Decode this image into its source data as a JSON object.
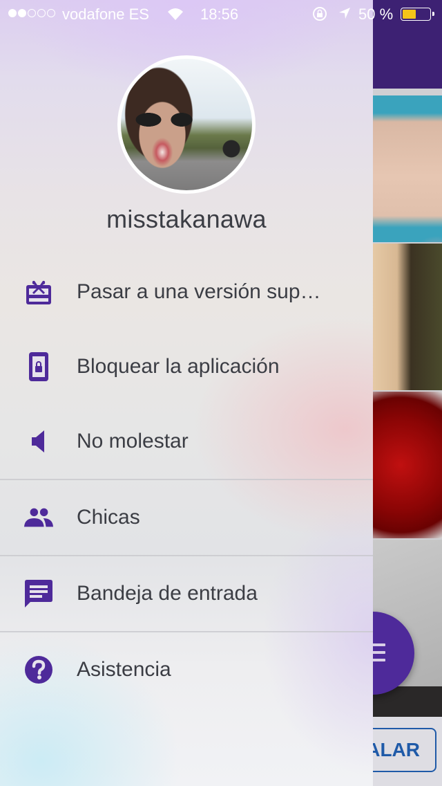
{
  "status_bar": {
    "signal_bars_filled": 2,
    "signal_bars_total": 5,
    "carrier": "vodafone ES",
    "time": "18:56",
    "battery_percent_label": "50 %",
    "battery_level": 0.5
  },
  "profile": {
    "username": "misstakanawa",
    "avatar_alt": "profile photo"
  },
  "menu": {
    "items": [
      {
        "label": "Pasar a una versión sup…",
        "icon": "gift-card-icon"
      },
      {
        "label": "Bloquear la aplicación",
        "icon": "phone-lock-icon"
      },
      {
        "label": "No molestar",
        "icon": "speaker-mute-icon"
      },
      {
        "label": "Chicas",
        "icon": "people-icon"
      },
      {
        "label": "Bandeja de entrada",
        "icon": "chat-message-icon"
      },
      {
        "label": "Asistencia",
        "icon": "help-circle-icon"
      }
    ]
  },
  "background_app": {
    "cta_label": "ALAR",
    "fab_icon": "menu-icon"
  },
  "colors": {
    "accent": "#4e2a9a",
    "header": "#3d2173",
    "text": "#3b3d44",
    "cta": "#1f5aa8",
    "battery": "#f5c518"
  }
}
